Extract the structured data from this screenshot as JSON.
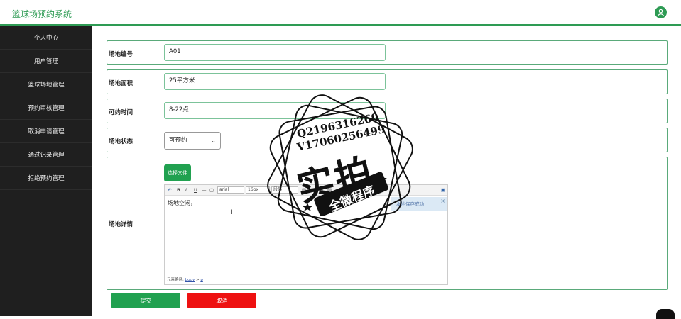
{
  "app": {
    "title": "篮球场预约系统"
  },
  "sidebar": {
    "items": [
      {
        "label": "个人中心"
      },
      {
        "label": "用户管理"
      },
      {
        "label": "篮球场地管理"
      },
      {
        "label": "预约审核管理"
      },
      {
        "label": "取消申请管理"
      },
      {
        "label": "通过记录管理"
      },
      {
        "label": "拒绝预约管理"
      }
    ]
  },
  "form": {
    "venue_no_label": "场地编号",
    "venue_no_value": "A01",
    "area_label": "场地面积",
    "area_value": "25平方米",
    "time_label": "可约时间",
    "time_value": "8-22点",
    "status_label": "场地状态",
    "status_value": "可预约",
    "detail_label": "场地详情",
    "choose_file": "选择文件",
    "editor": {
      "font_family": "arial",
      "font_size": "16px",
      "paragraph": "段落",
      "content": "场地空闲，",
      "tip": "本地保存成功",
      "path_label": "元素路径:",
      "path_body": "body",
      "path_sep": ">",
      "path_p": "p"
    },
    "submit": "提交",
    "cancel": "取消"
  },
  "watermark": {
    "line1": "Q2196316269",
    "line2": "V17060256499",
    "big": "实拍",
    "banner": "全微程序"
  },
  "colors": {
    "accent": "#2e9b54",
    "submit": "#21a150",
    "cancel": "#ee1111",
    "sidebar_bg": "#1f1f1f"
  }
}
